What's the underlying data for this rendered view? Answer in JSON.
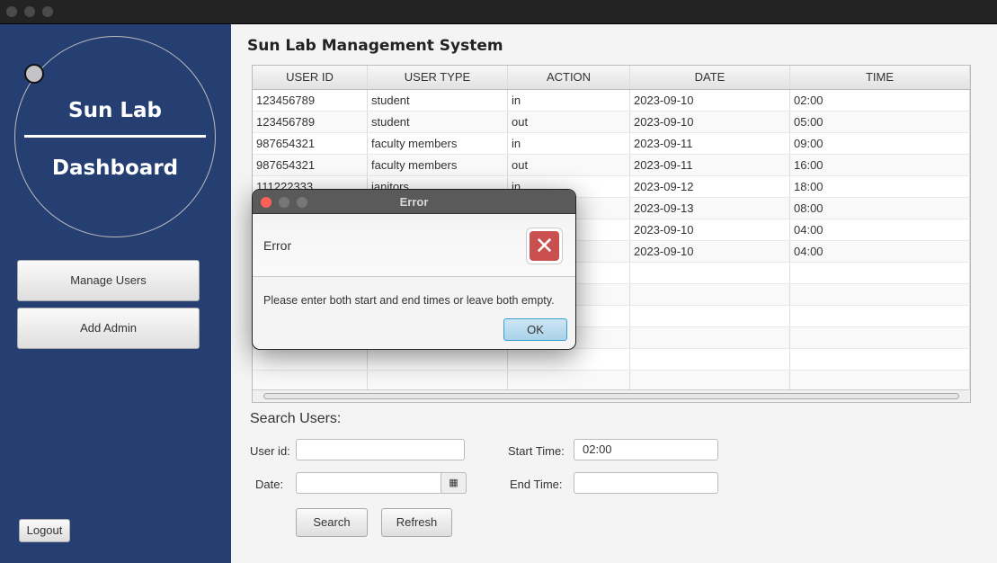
{
  "sidebar": {
    "title_line1": "Sun Lab",
    "title_line2": "Dashboard",
    "buttons": [
      "Manage Users",
      "Add Admin"
    ],
    "logout": "Logout"
  },
  "main": {
    "title": "Sun Lab Management System"
  },
  "table": {
    "columns": [
      "USER ID",
      "USER TYPE",
      "ACTION",
      "DATE",
      "TIME"
    ],
    "rows": [
      [
        "123456789",
        "student",
        "in",
        "2023-09-10",
        "02:00"
      ],
      [
        "123456789",
        "student",
        "out",
        "2023-09-10",
        "05:00"
      ],
      [
        "987654321",
        "faculty members",
        "in",
        "2023-09-11",
        "09:00"
      ],
      [
        "987654321",
        "faculty members",
        "out",
        "2023-09-11",
        "16:00"
      ],
      [
        "111222333",
        "janitors",
        "in",
        "2023-09-12",
        "18:00"
      ],
      [
        "",
        "",
        "",
        "2023-09-13",
        "08:00"
      ],
      [
        "",
        "",
        "",
        "2023-09-10",
        "04:00"
      ],
      [
        "",
        "",
        "",
        "2023-09-10",
        "04:00"
      ]
    ]
  },
  "search": {
    "title": "Search  Users:",
    "user_id_label": "User id:",
    "user_id_value": "",
    "date_label": "Date:",
    "date_value": "",
    "start_label": "Start Time:",
    "start_value": "02:00",
    "end_label": "End Time:",
    "end_value": "",
    "search_btn": "Search",
    "refresh_btn": "Refresh"
  },
  "dialog": {
    "title": "Error",
    "header": "Error",
    "message": "Please enter both start and end times or leave both empty.",
    "ok": "OK"
  }
}
